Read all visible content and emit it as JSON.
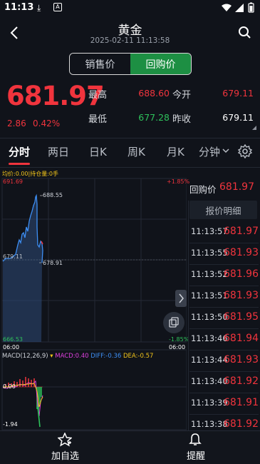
{
  "status_bar": {
    "time": "11:13"
  },
  "header": {
    "title": "黄金",
    "datetime": "2025-02-11 11:13:58"
  },
  "toggle": {
    "sell_label": "销售价",
    "buy_label": "回购价",
    "selected": "回购价"
  },
  "quote": {
    "price": "681.97",
    "change": "2.86",
    "change_pct": "0.42%",
    "high_label": "最高",
    "high_value": "688.60",
    "open_label": "今开",
    "open_value": "679.11",
    "low_label": "最低",
    "low_value": "677.28",
    "prev_close_label": "昨收",
    "prev_close_value": "679.11"
  },
  "tabs": [
    "分时",
    "两日",
    "日K",
    "周K",
    "月K",
    "分钟"
  ],
  "active_tab": "分时",
  "chart": {
    "legend": "均价:0.00|持仓量:0手",
    "y_top": "691.69",
    "y_bottom": "666.53",
    "pct_top": "+1.85%",
    "pct_bottom": "-1.85%",
    "max_marker": "688.55",
    "mid_label": "679.11",
    "last_marker": "678.91",
    "time_left": "06:00",
    "time_right": "06:00",
    "macd_label": "MACD(12,26,9)",
    "macd_value": "MACD:0.40",
    "diff_value": "DIFF:-0.36",
    "dea_value": "DEA:-0.57",
    "macd_zero": "0.00",
    "macd_min": "-1.94",
    "colors": {
      "up": "#f0343d",
      "down": "#2ec25b",
      "line": "#3d8ff5",
      "diff": "#e040e0",
      "dea": "#f2c419"
    }
  },
  "chart_data": {
    "type": "line",
    "title": "",
    "x": [
      "06:00",
      "06:00"
    ],
    "ylim": [
      666.53,
      691.69
    ],
    "series": [],
    "annotations": [
      "688.55",
      "678.91"
    ]
  },
  "side": {
    "header_label": "回购价",
    "header_value": "681.97",
    "detail_label": "报价明细",
    "rows": [
      {
        "time": "11:13:57",
        "price": "681.97"
      },
      {
        "time": "11:13:55",
        "price": "681.93"
      },
      {
        "time": "11:13:52",
        "price": "681.96"
      },
      {
        "time": "11:13:51",
        "price": "681.93"
      },
      {
        "time": "11:13:50",
        "price": "681.95"
      },
      {
        "time": "11:13:46",
        "price": "681.94"
      },
      {
        "time": "11:13:44",
        "price": "681.93"
      },
      {
        "time": "11:13:40",
        "price": "681.92"
      },
      {
        "time": "11:13:39",
        "price": "681.91"
      },
      {
        "time": "11:13:38",
        "price": "681.92"
      }
    ]
  },
  "bottom": {
    "watchlist_label": "加自选",
    "alert_label": "提醒"
  }
}
